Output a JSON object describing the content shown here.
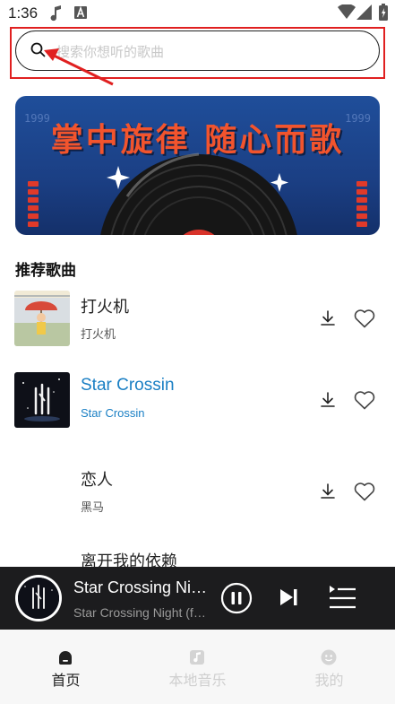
{
  "status_bar": {
    "time": "1:36",
    "icons": [
      "music-note-icon",
      "font-a-icon",
      "wifi-icon",
      "signal-icon",
      "battery-charging-icon"
    ]
  },
  "search": {
    "placeholder": "搜索你想听的歌曲",
    "icon": "search-icon",
    "highlight_color": "#e02020"
  },
  "banner": {
    "title": "掌中旋律 随心而歌",
    "side_text_left": "1999",
    "side_text_right": "1999",
    "title_color": "#f2542d",
    "background_color": "#1f4e9a"
  },
  "section": {
    "title": "推荐歌曲"
  },
  "songs": [
    {
      "title": "打火机",
      "artist": "打火机",
      "active": false
    },
    {
      "title": "Star Crossin",
      "artist": "Star Crossin",
      "active": true
    },
    {
      "title": "恋人",
      "artist": "黑马",
      "active": false
    },
    {
      "title": "离开我的依赖",
      "artist": "",
      "active": false
    }
  ],
  "player": {
    "title": "Star Crossing Night",
    "subtitle": "Star Crossing Night (feat. ...)",
    "controls": [
      "pause-icon",
      "next-icon",
      "playlist-icon"
    ]
  },
  "bottom_nav": [
    {
      "label": "首页",
      "icon": "home-icon",
      "active": true
    },
    {
      "label": "本地音乐",
      "icon": "local-music-icon",
      "active": false
    },
    {
      "label": "我的",
      "icon": "profile-icon",
      "active": false
    }
  ],
  "colors": {
    "accent": "#1a7fc4",
    "player_bg": "#1c1c1e",
    "nav_bg": "#f7f7f7"
  }
}
